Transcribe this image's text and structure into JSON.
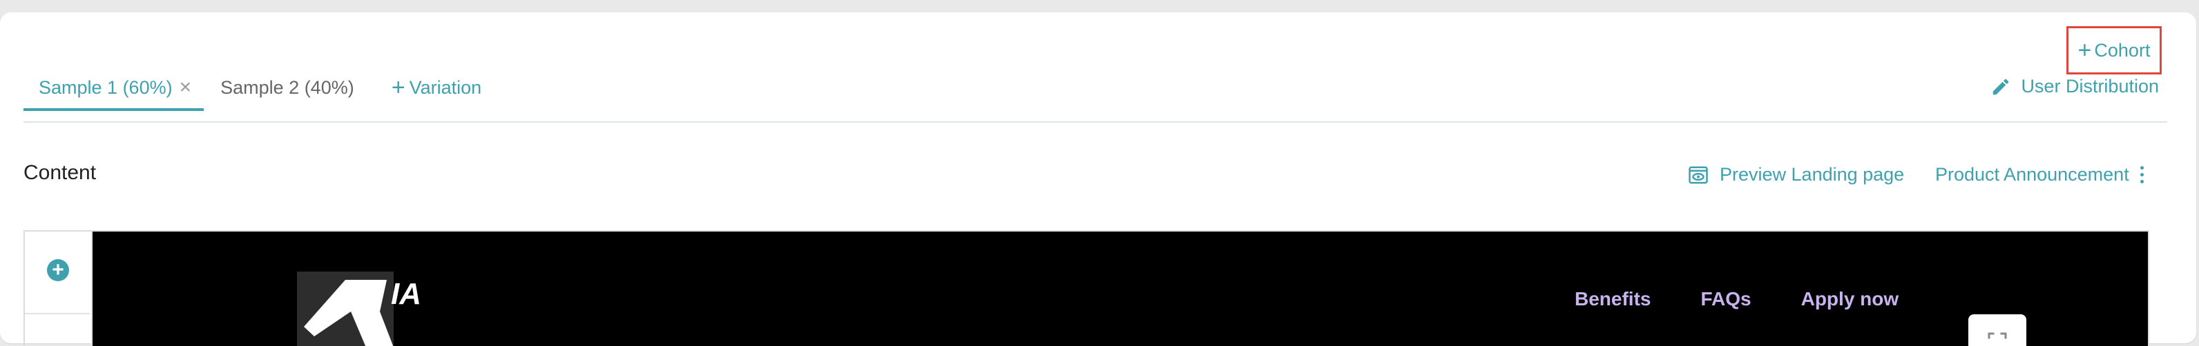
{
  "tabs": [
    {
      "label": "Sample 1 (60%)",
      "active": true,
      "closable": true
    },
    {
      "label": "Sample 2 (40%)",
      "active": false,
      "closable": false
    }
  ],
  "add_variation_label": "Variation",
  "cohort_button_label": "Cohort",
  "user_distribution_label": "User Distribution",
  "content_title": "Content",
  "preview_landing_label": "Preview Landing page",
  "announcement_label": "Product Announcement",
  "preview": {
    "logo_text": "IA",
    "nav": [
      "Benefits",
      "FAQs",
      "Apply now"
    ]
  },
  "colors": {
    "accent": "#3ea1ad",
    "highlight_border": "#e0473c",
    "preview_bg": "#000000",
    "nav_text": "#c9b3ee"
  },
  "icons": {
    "close": "close-icon",
    "plus": "plus-icon",
    "pencil": "pencil-icon",
    "eye": "eye-icon",
    "kebab": "kebab-menu-icon",
    "add_block": "plus-circle-icon",
    "expand": "expand-icon"
  }
}
